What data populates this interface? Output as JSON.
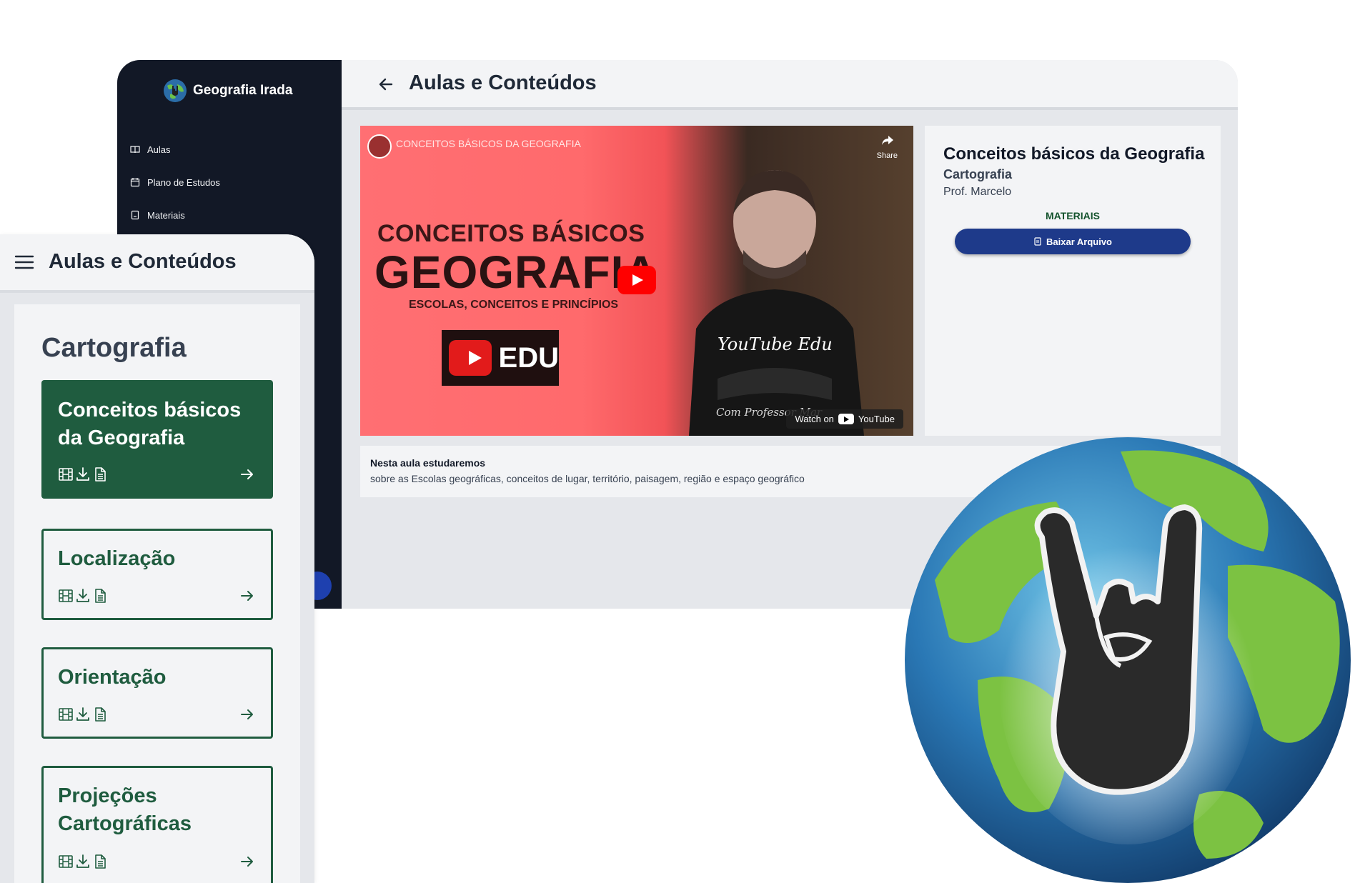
{
  "desktop": {
    "brand": "Geografia Irada",
    "nav": [
      {
        "label": "Aulas",
        "icon": "book-icon"
      },
      {
        "label": "Plano de Estudos",
        "icon": "calendar-icon"
      },
      {
        "label": "Materiais",
        "icon": "file-icon"
      }
    ],
    "page_title": "Aulas e Conteúdos",
    "video": {
      "title": "CONCEITOS BÁSICOS DA GEOGRAFIA",
      "share": "Share",
      "headline_1": "CONCEITOS BÁSICOS",
      "headline_2": "GEOGRAFIA",
      "headline_3": "ESCOLAS, CONCEITOS E PRINCÍPIOS",
      "badge": "EDU",
      "shirt_text": "YouTube Edu",
      "signature": "Com Professor Mar",
      "watch_on": "Watch on",
      "youtube": "YouTube"
    },
    "lesson": {
      "title": "Conceitos básicos da Geografia",
      "category": "Cartografia",
      "professor": "Prof. Marcelo",
      "materials_label": "MATERIAIS",
      "download_label": "Baixar Arquivo"
    },
    "description": {
      "title": "Nesta aula estudaremos",
      "text": "sobre as Escolas geográficas, conceitos de lugar, território, paisagem, região e espaço geográfico"
    }
  },
  "mobile": {
    "title": "Aulas e Conteúdos",
    "section": "Cartografia",
    "lessons": [
      {
        "title": "Conceitos básicos da Geografia",
        "active": true
      },
      {
        "title": "Localização",
        "active": false
      },
      {
        "title": "Orientação",
        "active": false
      },
      {
        "title": "Projeções Cartográficas",
        "active": false
      }
    ]
  },
  "colors": {
    "sidebar": "#121826",
    "accent_green": "#1f5c3f",
    "button_blue": "#1e3a8a"
  }
}
